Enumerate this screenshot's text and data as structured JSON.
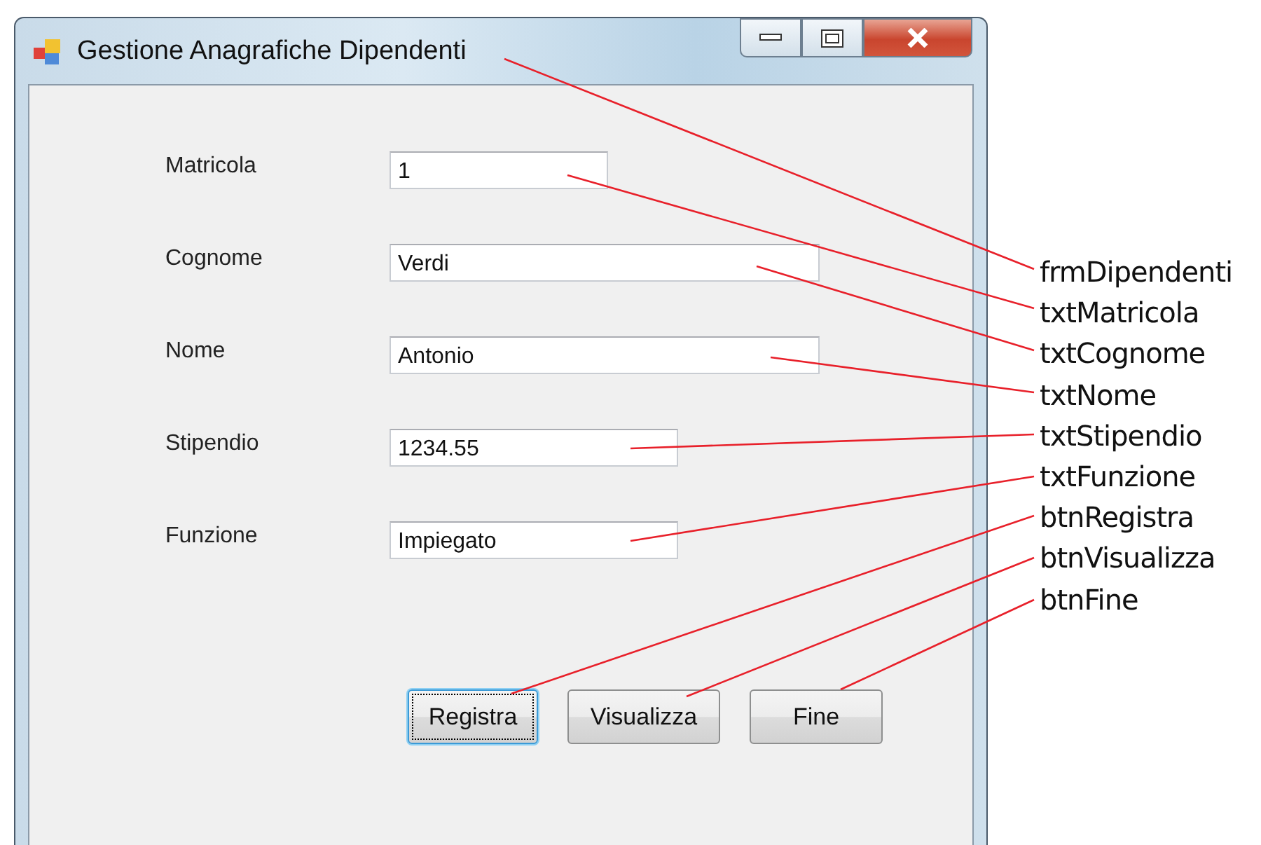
{
  "window": {
    "title": "Gestione Anagrafiche Dipendenti"
  },
  "fields": [
    {
      "label": "Matricola",
      "value": "1"
    },
    {
      "label": "Cognome",
      "value": "Verdi"
    },
    {
      "label": "Nome",
      "value": "Antonio"
    },
    {
      "label": "Stipendio",
      "value": "1234.55"
    },
    {
      "label": "Funzione",
      "value": "Impiegato"
    }
  ],
  "buttons": [
    {
      "label": "Registra",
      "focused": true
    },
    {
      "label": "Visualizza",
      "focused": false
    },
    {
      "label": "Fine",
      "focused": false
    }
  ],
  "annotations": [
    "frmDipendenti",
    "txtMatricola",
    "txtCognome",
    "txtNome",
    "txtStipendio",
    "txtFunzione",
    "btnRegistra",
    "btnVisualizza",
    "btnFine"
  ]
}
